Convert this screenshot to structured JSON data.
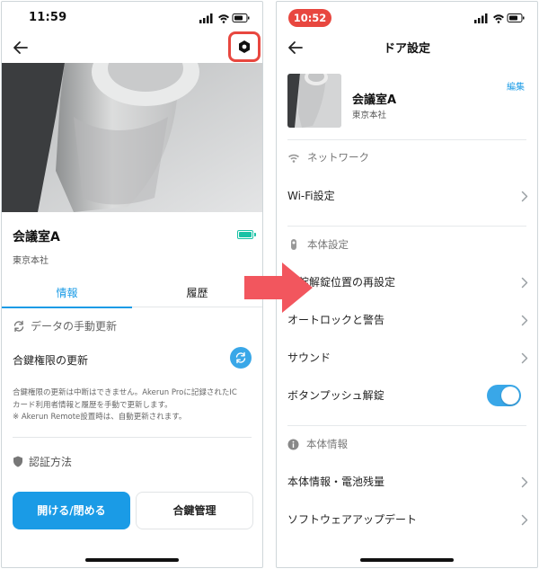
{
  "left_screen": {
    "status_time": "11:59",
    "device": {
      "name": "会議室A",
      "location": "東京本社"
    },
    "tabs": [
      {
        "label": "情報",
        "active": true
      },
      {
        "label": "履歴",
        "active": false
      }
    ],
    "refresh_label": "データの手動更新",
    "key_update_label": "合鍵権限の更新",
    "note_lines": [
      "合鍵権限の更新は中断はできません。Akerun Proに記録されたIC",
      "カード利用者情報と履歴を手動で更新します。",
      "※ Akerun Remote設置時は、自動更新されます。"
    ],
    "auth_label": "認証方法",
    "primary_button": "開ける/閉める",
    "secondary_button": "合鍵管理",
    "battery": {
      "level": 1.0,
      "color": "#19c2a5"
    }
  },
  "right_screen": {
    "status_time": "10:52",
    "title": "ドア設定",
    "device": {
      "name": "会議室A",
      "location": "東京本社"
    },
    "edit_label": "編集",
    "sections": {
      "network": "ネットワーク",
      "body_settings": "本体設定",
      "body_info": "本体情報"
    },
    "items": {
      "wifi": "Wi-Fi設定",
      "reset_lock_position": "施錠解錠位置の再設定",
      "autolock": "オートロックと警告",
      "sound": "サウンド",
      "push_unlock": "ボタンプッシュ解錠",
      "body_battery": "本体情報・電池残量",
      "software_update": "ソフトウェアアップデート"
    },
    "push_unlock_on": true
  },
  "colors": {
    "accent": "#1a9be6",
    "highlight": "#e8473f",
    "arrow": "#f2565e",
    "toggle": "#39a7e8"
  },
  "icons": {
    "back": "arrow-left-icon",
    "settings": "gear-icon",
    "refresh": "refresh-icon",
    "shield": "shield-icon",
    "wifi": "wifi-icon",
    "device": "device-icon",
    "info": "info-icon",
    "chevron": "chevron-right-icon"
  }
}
